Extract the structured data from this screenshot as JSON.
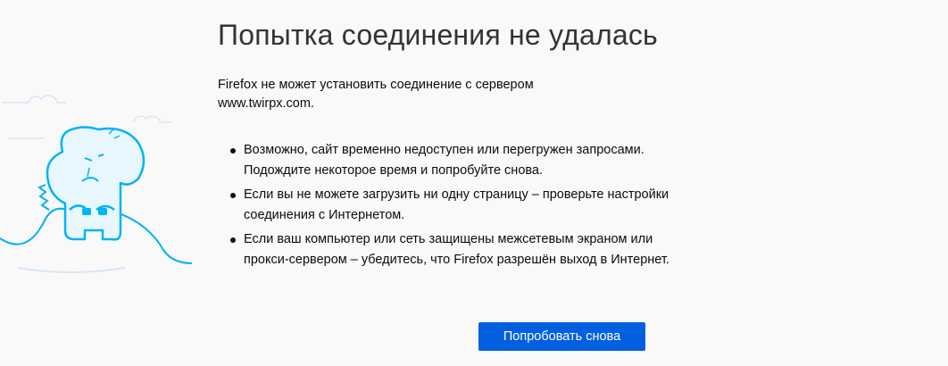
{
  "error": {
    "title": "Попытка соединения не удалась",
    "intro_line1": "Firefox не может установить соединение с сервером",
    "intro_line2": "www.twirpx.com.",
    "reasons": [
      "Возможно, сайт временно недоступен или перегружен запросами. Подождите некоторое время и попробуйте снова.",
      "Если вы не можете загрузить ни одну страницу – проверьте настройки соединения с Интернетом.",
      "Если ваш компьютер или сеть защищены межсетевым экраном или прокси-сервером – убедитесь, что Firefox разрешён выход в Интернет."
    ],
    "retry_label": "Попробовать снова"
  },
  "illustration": {
    "icon": "unplugged-dinosaur-icon",
    "color": "#00b3f4"
  },
  "colors": {
    "background": "#f9f9fa",
    "button": "#0060df",
    "button_text": "#ffffff"
  }
}
